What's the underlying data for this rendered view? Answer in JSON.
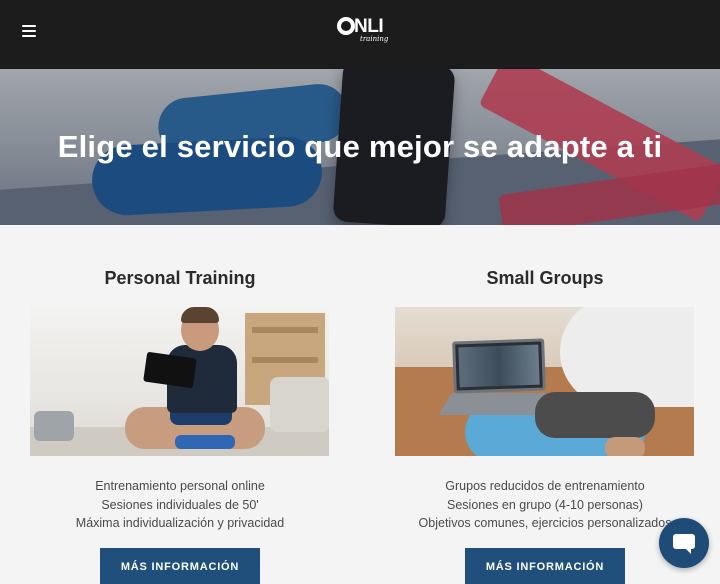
{
  "header": {
    "menu_icon": "hamburger-menu-icon",
    "logo": {
      "text": "NLI",
      "sub": "training"
    }
  },
  "hero": {
    "title": "Elige el servicio que mejor se adapte a ti"
  },
  "services": [
    {
      "title": "Personal Training",
      "lines": [
        "Entrenamiento personal online",
        "Sesiones individuales de 50'",
        "Máxima individualización y privacidad"
      ],
      "button": "MÁS INFORMACIÓN"
    },
    {
      "title": "Small Groups",
      "lines": [
        "Grupos reducidos de entrenamiento",
        "Sesiones en grupo (4-10 personas)",
        "Objetivos comunes, ejercicios personalizados"
      ],
      "button": "MÁS INFORMACIÓN"
    }
  ],
  "chat": {
    "icon": "chat-bubble-icon"
  },
  "colors": {
    "header_bg": "#1c1c1c",
    "button_bg": "#1f4f7a",
    "page_bg": "#f4f4f4"
  }
}
